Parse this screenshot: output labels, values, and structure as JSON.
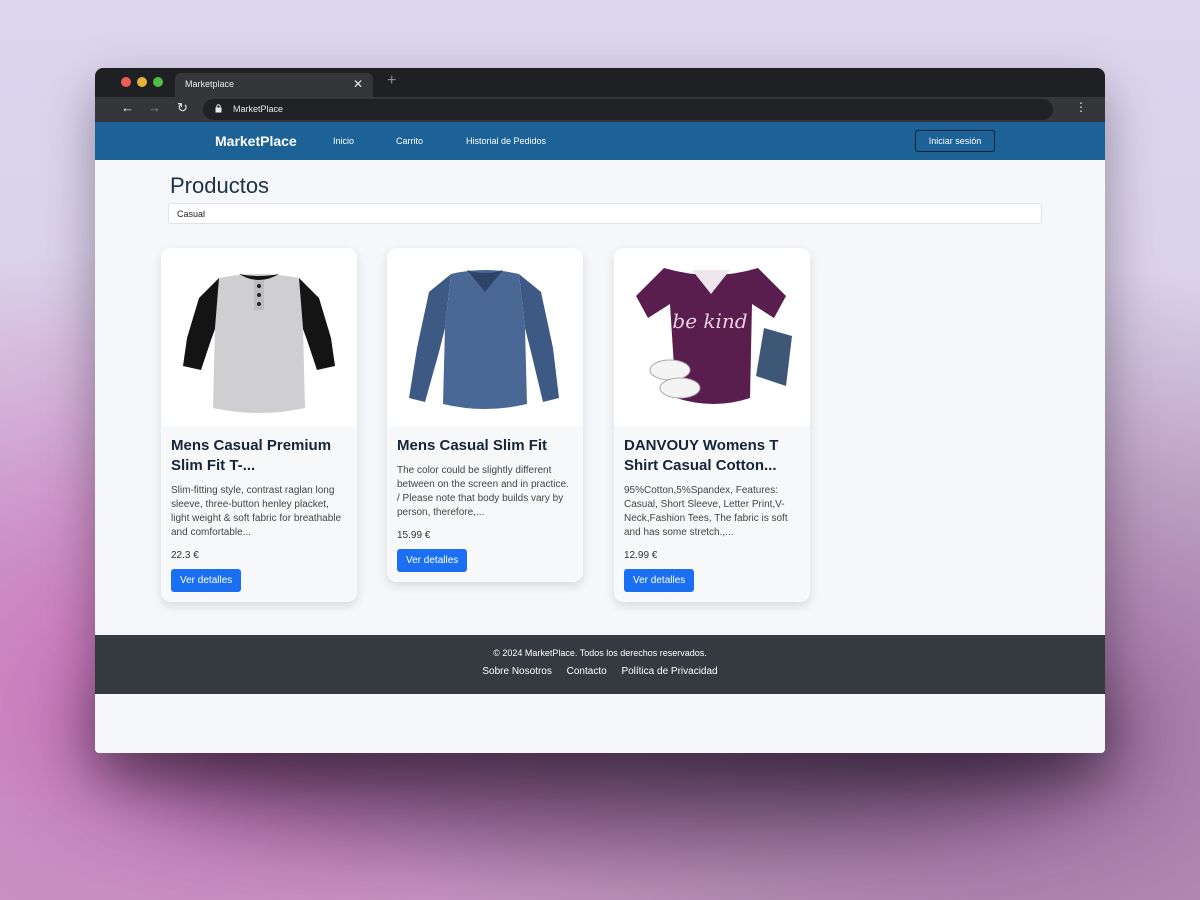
{
  "browser": {
    "tab_title": "Marketplace",
    "tab_close": "✕",
    "new_tab": "+",
    "url": "MarketPlace"
  },
  "navbar": {
    "brand": "MarketPlace",
    "links": [
      "Inicio",
      "Carrito",
      "Historial de Pedidos"
    ],
    "login_label": "Iniciar sesión"
  },
  "main": {
    "title": "Productos",
    "search_value": "Casual"
  },
  "products": [
    {
      "title": "Mens Casual Premium Slim Fit T-...",
      "description": "Slim-fitting style, contrast raglan long sleeve, three-button henley placket, light weight & soft fabric for breathable and comfortable...",
      "price": "22.3 €",
      "button_label": "Ver detalles",
      "image_icon": "raglan-henley-shirt-icon"
    },
    {
      "title": "Mens Casual Slim Fit",
      "description": "The color could be slightly different between on the screen and in practice. / Please note that body builds vary by person, therefore,...",
      "price": "15.99 €",
      "button_label": "Ver detalles",
      "image_icon": "long-sleeve-shirt-icon"
    },
    {
      "title": "DANVOUY Womens T Shirt Casual Cotton...",
      "description": "95%Cotton,5%Spandex, Features: Casual, Short Sleeve, Letter Print,V-Neck,Fashion Tees, The fabric is soft and has some stretch.,...",
      "price": "12.99 €",
      "button_label": "Ver detalles",
      "image_icon": "be-kind-tshirt-icon",
      "image_text": "be kind"
    }
  ],
  "footer": {
    "copyright": "© 2024 MarketPlace. Todos los derechos reservados.",
    "links": [
      "Sobre Nosotros",
      "Contacto",
      "Política de Privacidad"
    ]
  },
  "colors": {
    "navbar": "#1c6296",
    "footer": "#343a40",
    "button": "#1b6ff3",
    "purple_shirt": "#5a1e4e"
  }
}
